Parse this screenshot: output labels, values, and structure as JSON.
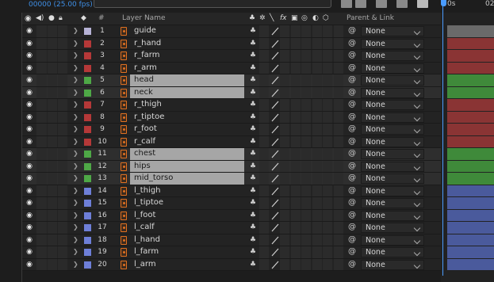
{
  "timecode": "00000 (25.00 fps)",
  "ruler": {
    "label_0": "0s",
    "label_1": "02"
  },
  "header": {
    "col_layer_name": "Layer Name",
    "col_num": "#",
    "col_parent": "Parent & Link",
    "fx_glyph": "fx"
  },
  "colors": {
    "lavender": "#b6b2d6",
    "red": "#b53838",
    "green": "#4ea846",
    "blue": "#6e7fd8",
    "bar_gray": "#6a6a6a",
    "bar_red": "#8a3434",
    "bar_green": "#3f8a3a",
    "bar_blue": "#4a5a9c",
    "timecode": "#3f8fe6"
  },
  "layers": [
    {
      "num": "1",
      "name": "guide",
      "color": "lavender",
      "selected": false,
      "parent": "None"
    },
    {
      "num": "2",
      "name": "r_hand",
      "color": "red",
      "selected": false,
      "parent": "None"
    },
    {
      "num": "3",
      "name": "r_farm",
      "color": "red",
      "selected": false,
      "parent": "None"
    },
    {
      "num": "4",
      "name": "r_arm",
      "color": "red",
      "selected": false,
      "parent": "None"
    },
    {
      "num": "5",
      "name": "head",
      "color": "green",
      "selected": true,
      "parent": "None"
    },
    {
      "num": "6",
      "name": "neck",
      "color": "green",
      "selected": true,
      "parent": "None"
    },
    {
      "num": "7",
      "name": "r_thigh",
      "color": "red",
      "selected": false,
      "parent": "None"
    },
    {
      "num": "8",
      "name": "r_tiptoe",
      "color": "red",
      "selected": false,
      "parent": "None"
    },
    {
      "num": "9",
      "name": "r_foot",
      "color": "red",
      "selected": false,
      "parent": "None"
    },
    {
      "num": "10",
      "name": "r_calf",
      "color": "red",
      "selected": false,
      "parent": "None"
    },
    {
      "num": "11",
      "name": "chest",
      "color": "green",
      "selected": true,
      "parent": "None"
    },
    {
      "num": "12",
      "name": "hips",
      "color": "green",
      "selected": true,
      "parent": "None"
    },
    {
      "num": "13",
      "name": "mid_torso",
      "color": "green",
      "selected": true,
      "parent": "None"
    },
    {
      "num": "14",
      "name": "l_thigh",
      "color": "blue",
      "selected": false,
      "parent": "None"
    },
    {
      "num": "15",
      "name": "l_tiptoe",
      "color": "blue",
      "selected": false,
      "parent": "None"
    },
    {
      "num": "16",
      "name": "l_foot",
      "color": "blue",
      "selected": false,
      "parent": "None"
    },
    {
      "num": "17",
      "name": "l_calf",
      "color": "blue",
      "selected": false,
      "parent": "None"
    },
    {
      "num": "18",
      "name": "l_hand",
      "color": "blue",
      "selected": false,
      "parent": "None"
    },
    {
      "num": "19",
      "name": "l_farm",
      "color": "blue",
      "selected": false,
      "parent": "None"
    },
    {
      "num": "20",
      "name": "l_arm",
      "color": "blue",
      "selected": false,
      "parent": "None"
    }
  ]
}
